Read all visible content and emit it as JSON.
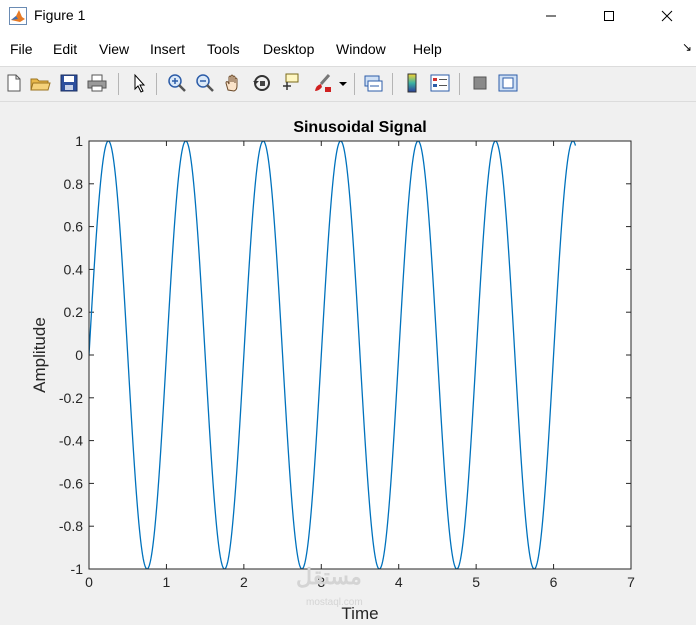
{
  "window": {
    "title": "Figure 1"
  },
  "menu": [
    "File",
    "Edit",
    "View",
    "Insert",
    "Tools",
    "Desktop",
    "Window",
    "Help"
  ],
  "toolbar_icons": [
    "new-figure-icon",
    "open-file-icon",
    "save-icon",
    "print-icon",
    "edit-plot-arrow-icon",
    "zoom-in-icon",
    "zoom-out-icon",
    "pan-hand-icon",
    "rotate-3d-icon",
    "data-cursor-icon",
    "brush-icon",
    "link-plot-icon",
    "colorbar-icon",
    "legend-icon",
    "hide-plot-tools-icon",
    "show-plot-tools-icon"
  ],
  "watermark": {
    "text": "مستقل",
    "sub": "mostaql.com"
  },
  "chart_data": {
    "type": "line",
    "title": "Sinusoidal Signal",
    "xlabel": "Time",
    "ylabel": "Amplitude",
    "xlim": [
      0,
      7
    ],
    "ylim": [
      -1,
      1
    ],
    "xticks": [
      0,
      1,
      2,
      3,
      4,
      5,
      6,
      7
    ],
    "yticks": [
      -1,
      -0.8,
      -0.6,
      -0.4,
      -0.2,
      0,
      0.2,
      0.4,
      0.6,
      0.8,
      1
    ],
    "grid": false,
    "series": [
      {
        "color": "#0072bd",
        "x_range": [
          0,
          6.283
        ],
        "frequency": 1,
        "amplitude": 1,
        "expression": "y = sin(2*pi*f*t)"
      }
    ]
  }
}
